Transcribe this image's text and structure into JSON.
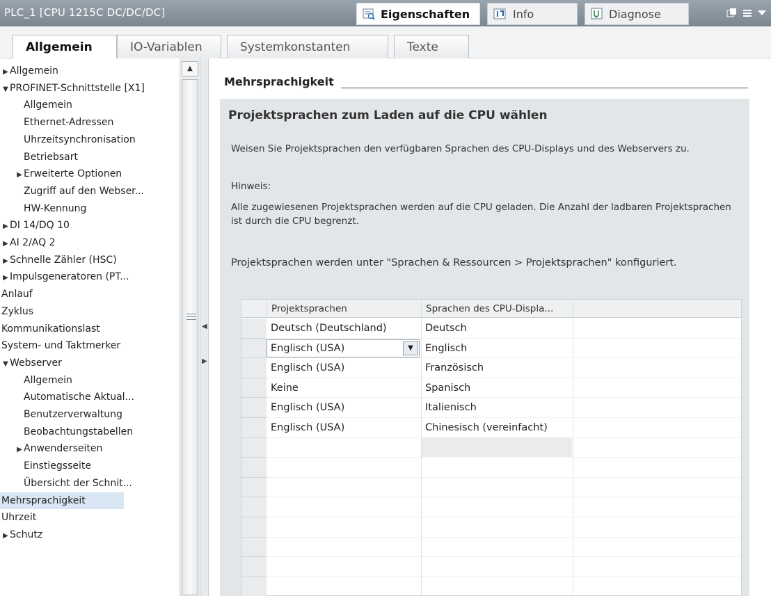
{
  "window": {
    "title": "PLC_1 [CPU 1215C DC/DC/DC]",
    "top_tabs": [
      {
        "label": "Eigenschaften",
        "icon": "properties-icon",
        "active": true
      },
      {
        "label": "Info",
        "icon": "info-icon",
        "active": false
      },
      {
        "label": "Diagnose",
        "icon": "diagnose-icon",
        "active": false
      }
    ]
  },
  "tabs": [
    {
      "label": "Allgemein",
      "active": true
    },
    {
      "label": "IO-Variablen",
      "active": false
    },
    {
      "label": "Systemkonstanten",
      "active": false
    },
    {
      "label": "Texte",
      "active": false
    }
  ],
  "tree": [
    {
      "label": "Allgemein",
      "level": 0,
      "arrow": "collapsed"
    },
    {
      "label": "PROFINET-Schnittstelle [X1]",
      "level": 0,
      "arrow": "expanded"
    },
    {
      "label": "Allgemein",
      "level": 1,
      "arrow": "none"
    },
    {
      "label": "Ethernet-Adressen",
      "level": 1,
      "arrow": "none"
    },
    {
      "label": "Uhrzeitsynchronisation",
      "level": 1,
      "arrow": "none"
    },
    {
      "label": "Betriebsart",
      "level": 1,
      "arrow": "none"
    },
    {
      "label": "Erweiterte Optionen",
      "level": 1,
      "arrow": "collapsed"
    },
    {
      "label": "Zugriff auf den Webser...",
      "level": 1,
      "arrow": "none"
    },
    {
      "label": "HW-Kennung",
      "level": 1,
      "arrow": "none"
    },
    {
      "label": "DI 14/DQ 10",
      "level": 0,
      "arrow": "collapsed"
    },
    {
      "label": "AI 2/AQ 2",
      "level": 0,
      "arrow": "collapsed"
    },
    {
      "label": "Schnelle Zähler (HSC)",
      "level": 0,
      "arrow": "collapsed"
    },
    {
      "label": "Impulsgeneratoren (PT...",
      "level": 0,
      "arrow": "collapsed"
    },
    {
      "label": "Anlauf",
      "level": 0,
      "arrow": "none"
    },
    {
      "label": "Zyklus",
      "level": 0,
      "arrow": "none"
    },
    {
      "label": "Kommunikationslast",
      "level": 0,
      "arrow": "none"
    },
    {
      "label": "System- und Taktmerker",
      "level": 0,
      "arrow": "none"
    },
    {
      "label": "Webserver",
      "level": 0,
      "arrow": "expanded"
    },
    {
      "label": "Allgemein",
      "level": 1,
      "arrow": "none"
    },
    {
      "label": "Automatische Aktual...",
      "level": 1,
      "arrow": "none"
    },
    {
      "label": "Benutzerverwaltung",
      "level": 1,
      "arrow": "none"
    },
    {
      "label": "Beobachtungstabellen",
      "level": 1,
      "arrow": "none"
    },
    {
      "label": "Anwenderseiten",
      "level": 1,
      "arrow": "collapsed"
    },
    {
      "label": "Einstiegsseite",
      "level": 1,
      "arrow": "none"
    },
    {
      "label": "Übersicht der Schnit...",
      "level": 1,
      "arrow": "none"
    },
    {
      "label": "Mehrsprachigkeit",
      "level": 0,
      "arrow": "none",
      "selected": true
    },
    {
      "label": "Uhrzeit",
      "level": 0,
      "arrow": "none"
    },
    {
      "label": "Schutz",
      "level": 0,
      "arrow": "collapsed"
    }
  ],
  "main": {
    "section_title": "Mehrsprachigkeit",
    "panel_title": "Projektsprachen zum Laden auf die CPU wählen",
    "intro": "Weisen Sie Projektsprachen den verfügbaren Sprachen des CPU-Displays und des Webservers zu.",
    "hint_label": "Hinweis:",
    "hint_text": "Alle zugewiesenen Projektsprachen werden auf die CPU geladen. Die Anzahl der ladbaren Projektsprachen ist durch die CPU begrenzt.",
    "config_note": "Projektsprachen werden unter \"Sprachen & Ressourcen > Projektsprachen\" konfiguriert."
  },
  "table": {
    "headers": [
      "Projektsprachen",
      "Sprachen des CPU-Displa..."
    ],
    "rows": [
      {
        "project_language": "Deutsch (Deutschland)",
        "cpu_language": "Deutsch"
      },
      {
        "project_language": "Englisch (USA)",
        "cpu_language": "Englisch",
        "editing": true
      },
      {
        "project_language": "Englisch (USA)",
        "cpu_language": "Französisch"
      },
      {
        "project_language": "Keine",
        "cpu_language": "Spanisch"
      },
      {
        "project_language": "Englisch (USA)",
        "cpu_language": "Italienisch"
      },
      {
        "project_language": "Englisch (USA)",
        "cpu_language": "Chinesisch (vereinfacht)"
      }
    ]
  }
}
